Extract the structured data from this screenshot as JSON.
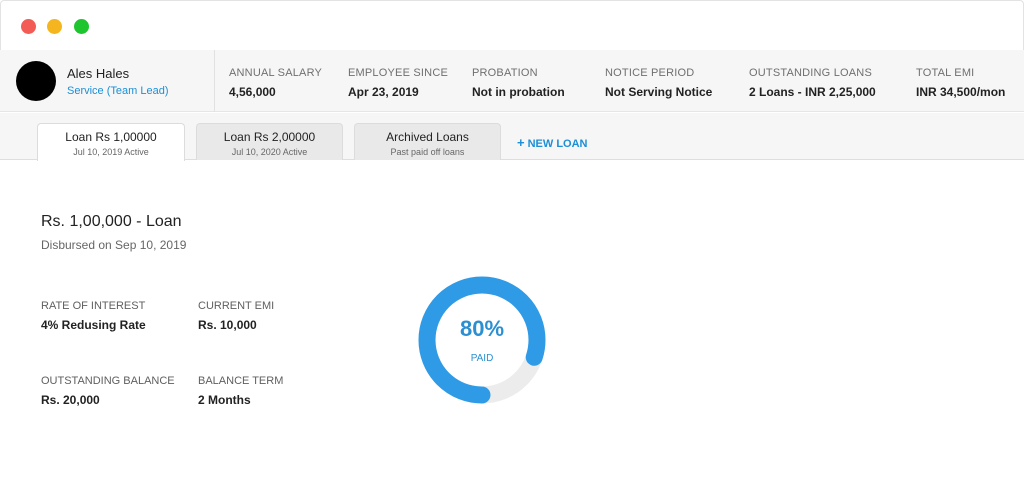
{
  "employee": {
    "name": "Ales Hales",
    "role": "Service (Team Lead)"
  },
  "stats": [
    {
      "label": "ANNUAL SALARY",
      "value": "4,56,000"
    },
    {
      "label": "EMPLOYEE SINCE",
      "value": "Apr 23, 2019"
    },
    {
      "label": "PROBATION",
      "value": "Not in probation"
    },
    {
      "label": "NOTICE PERIOD",
      "value": "Not Serving Notice"
    },
    {
      "label": "OUTSTANDING LOANS",
      "value": "2 Loans - INR 2,25,000"
    },
    {
      "label": "TOTAL EMI",
      "value": "INR 34,500/mon"
    }
  ],
  "tabs": [
    {
      "title": "Loan Rs 1,00000",
      "subtitle": "Jul 10, 2019 Active",
      "active": true
    },
    {
      "title": "Loan Rs 2,00000",
      "subtitle": "Jul 10, 2020 Active",
      "active": false
    },
    {
      "title": "Archived Loans",
      "subtitle": "Past paid off loans",
      "active": false
    }
  ],
  "new_loan_label": "NEW LOAN",
  "loan": {
    "title": "Rs. 1,00,000 - Loan",
    "disbursed": "Disbursed on Sep 10, 2019",
    "fields": [
      {
        "label": "RATE OF INTEREST",
        "value": "4% Redusing Rate"
      },
      {
        "label": "CURRENT EMI",
        "value": "Rs. 10,000"
      },
      {
        "label": "OUTSTANDING BALANCE",
        "value": "Rs. 20,000"
      },
      {
        "label": "BALANCE TERM",
        "value": "2 Months"
      }
    ],
    "progress": {
      "percent_text": "80%",
      "label": "PAID",
      "fraction": 0.8
    }
  },
  "colors": {
    "accent": "#1c8fd6",
    "progress": "#2f9ae6",
    "track": "#ececec",
    "close": "#f25c54",
    "minimize": "#f5b51f",
    "maximize": "#1fc52f"
  }
}
